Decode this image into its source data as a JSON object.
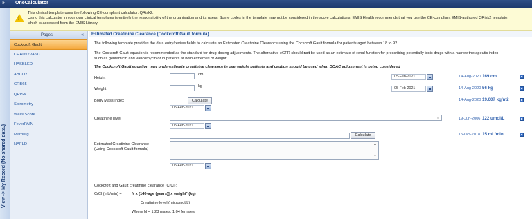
{
  "titlebar": {
    "collapse": "»",
    "title": "OneCalculator"
  },
  "sidebar_vertical": "View -> My Record (No shared data.)",
  "banner": {
    "line1": "This clinical template uses the following CE-compliant calculator: QRisk2.",
    "line2": "Using this calculator in your own clinical templates is entirely the responsibility of the organisation and its users. Some codes in the template may not be considered in the score calculations. EMIS Health recommends that you use the CE-compliant EMIS-authored QRisk2 template,",
    "line3": "which is accessed from the EMIS Library."
  },
  "pages": {
    "header": "Pages",
    "collapse": "«",
    "items": [
      "Cockcroft Gault",
      "CHADs2VASC",
      "HASBLED",
      "ABCD2",
      "CRB65",
      "QRISK",
      "Spirometry",
      "Wells Score",
      "FeverPAIN",
      "Marburg",
      "NAFLD"
    ],
    "active": "Cockcroft Gault"
  },
  "main": {
    "heading": "Estimated Creatinine Clearance (Cockcroft Gault formula)",
    "intro1": "The following template provides the data entry/review fields to calculate an Estimated Creatinine Clearance using the Cockcroft Gault formula for patients aged between 18 to 92.",
    "intro2a": "The Cockcroft Gault equation is recommended as the standard for drug dosing adjustments. The alternative eGFR should",
    "intro2_not": "not",
    "intro2b": "be used as an estimate of renal function for prescribing potentially toxic drugs with a narrow therapeutic index",
    "intro3": "such as gentamicin and vancomycin or in patients at both extremes of weight.",
    "warning": "The Cockcroft Gault equation may underestimate creatinine clearance in overweight patients and caution should be used when DOAC adjustment is being considered",
    "height": {
      "label": "Height",
      "unit": "cm",
      "date": "05-Feb-2021",
      "hist_date": "14-Aug-2020",
      "hist_value": "169 cm"
    },
    "weight": {
      "label": "Weight",
      "unit": "kg",
      "date": "05-Feb-2021",
      "hist_date": "14-Aug-2020",
      "hist_value": "56 kg"
    },
    "bmi": {
      "label": "Body Mass Index",
      "button": "Calculate",
      "date": "05-Feb-2021",
      "hist_date": "14-Aug-2020",
      "hist_value": "19.607 kg/m2"
    },
    "creatinine": {
      "label": "Creatinine level",
      "date": "05-Feb-2021",
      "hist_date": "19-Jun-2006",
      "hist_value": "122 umol/L"
    },
    "calc_button": "Calculate",
    "crcl_hist": {
      "date": "15-Oct-2018",
      "value": "15 mL/min"
    },
    "ecc": {
      "label1": "Estimated Creatinine Clearance",
      "label2": "(Using Cockcroft Gault formula)",
      "date": "05-Feb-2021"
    },
    "formula": {
      "title": "Cockcroft and Gault creatinine clearance (CrCl):",
      "lhs": "CrCl (mL/min) =",
      "numerator": "N x [140-age (years)] x weight* (kg)",
      "denominator": "Creatinine level (micromol/L)",
      "where": "Where N = 1.23 males, 1.04 females"
    }
  }
}
